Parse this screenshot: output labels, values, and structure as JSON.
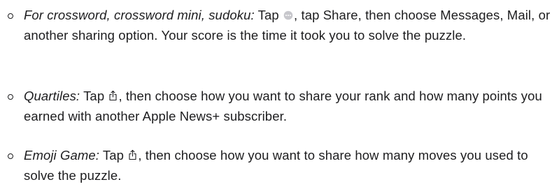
{
  "items": [
    {
      "title": "For crossword, crossword mini, sudoku:",
      "text_before_icon": " Tap ",
      "icon": "more-icon",
      "text_after_icon": ", tap Share, then choose Messages, Mail, or another sharing option. Your score is the time it took you to solve the puzzle."
    },
    {
      "title": "Quartiles:",
      "text_before_icon": " Tap ",
      "icon": "share-icon",
      "text_after_icon": ", then choose how you want to share your rank and how many points you earned with another Apple News+ subscriber."
    },
    {
      "title": "Emoji Game:",
      "text_before_icon": " Tap ",
      "icon": "share-icon",
      "text_after_icon": ", then choose how you want to share how many moves you used to solve the puzzle."
    }
  ]
}
